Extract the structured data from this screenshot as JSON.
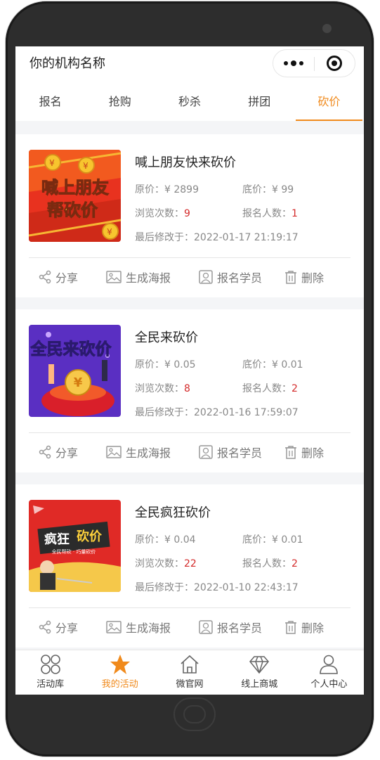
{
  "app": {
    "title": "你的机构名称"
  },
  "tabs": [
    {
      "label": "报名"
    },
    {
      "label": "抢购"
    },
    {
      "label": "秒杀"
    },
    {
      "label": "拼团"
    },
    {
      "label": "砍价",
      "active": true
    }
  ],
  "labels": {
    "original_price": "原价：",
    "floor_price": "底价：",
    "views": "浏览次数：",
    "signups": "报名人数：",
    "modified": "最后修改于：",
    "share": "分享",
    "poster": "生成海报",
    "students": "报名学员",
    "delete": "删除"
  },
  "activities": [
    {
      "title": "喊上朋友快来砍价",
      "original_price": "¥ 2899",
      "floor_price": "¥ 99",
      "views": "9",
      "signups": "1",
      "modified_at": "2022-01-17 21:19:17",
      "thumb_text": "喊上朋友帮砍价"
    },
    {
      "title": "全民来砍价",
      "original_price": "¥ 0.05",
      "floor_price": "¥ 0.01",
      "views": "8",
      "signups": "2",
      "modified_at": "2022-01-16 17:59:07",
      "thumb_text": "全民来砍价"
    },
    {
      "title": "全民疯狂砍价",
      "original_price": "¥ 0.04",
      "floor_price": "¥ 0.01",
      "views": "22",
      "signups": "2",
      "modified_at": "2022-01-10 22:43:17",
      "thumb_text": "疯狂砍价",
      "thumb_sub": "全民帮砍 · 巧量砍价"
    }
  ],
  "tabbar": [
    {
      "label": "活动库",
      "icon": "grid-icon"
    },
    {
      "label": "我的活动",
      "icon": "star-icon",
      "active": true
    },
    {
      "label": "微官网",
      "icon": "home-icon"
    },
    {
      "label": "线上商城",
      "icon": "diamond-icon"
    },
    {
      "label": "个人中心",
      "icon": "person-icon"
    }
  ],
  "colors": {
    "accent": "#f08a1c",
    "number": "#d42b2b"
  }
}
